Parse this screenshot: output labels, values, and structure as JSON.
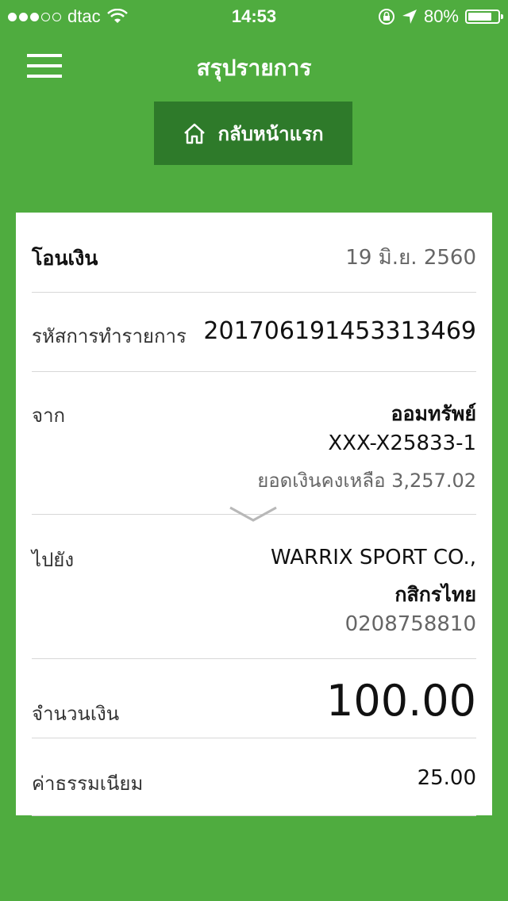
{
  "status_bar": {
    "carrier": "dtac",
    "time": "14:53",
    "battery": "80%",
    "battery_level": 0.8,
    "signal_bars_filled": 3,
    "signal_bars_total": 5
  },
  "nav": {
    "title": "สรุปรายการ",
    "home_button_label": "กลับหน้าแรก"
  },
  "transaction": {
    "type_label": "โอนเงิน",
    "date": "19 มิ.ย. 2560",
    "ref_label": "รหัสการทำรายการ",
    "ref_value": "201706191453313469",
    "from_label": "จาก",
    "from_account_name": "ออมทรัพย์",
    "from_account_number": "XXX-X25833-1",
    "from_balance_label": "ยอดเงินคงเหลือ 3,257.02",
    "to_label": "ไปยัง",
    "to_name": "WARRIX SPORT CO.,",
    "to_bank": "กสิกรไทย",
    "to_account_number": "0208758810",
    "amount_label": "จำนวนเงิน",
    "amount_value": "100.00",
    "fee_label": "ค่าธรรมเนียม",
    "fee_value": "25.00"
  },
  "colors": {
    "background": "#4fac3f",
    "home_button": "#2e7a2a",
    "card": "#ffffff"
  },
  "icons": {
    "menu": "hamburger-icon",
    "home": "home-icon",
    "expand": "chevron-down-icon"
  }
}
